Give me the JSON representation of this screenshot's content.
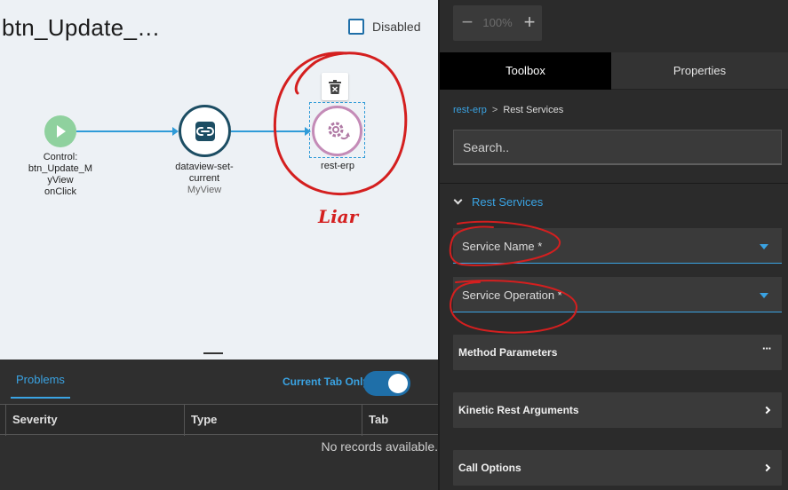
{
  "canvas": {
    "title": "btn_Update_…",
    "disabled_label": "Disabled",
    "nodes": {
      "start": {
        "line1": "Control:",
        "line2": "btn_Update_M",
        "line3": "yView",
        "line4": "onClick"
      },
      "dataview": {
        "line1": "dataview-set-",
        "line2": "current",
        "sub": "MyView"
      },
      "rest": {
        "label": "rest-erp"
      }
    },
    "annotation_text": "Liar"
  },
  "problems": {
    "tab_label": "Problems",
    "current_tab_only_label": "Current Tab Only",
    "current_tab_only": true,
    "columns": [
      "Severity",
      "Type",
      "Tab"
    ],
    "empty_text": "No records available."
  },
  "right_panel": {
    "zoom": {
      "minus": "−",
      "value": "100%",
      "plus": "+"
    },
    "tabs": {
      "toolbox": "Toolbox",
      "properties": "Properties"
    },
    "breadcrumb": {
      "root": "rest-erp",
      "separator": ">",
      "current": "Rest Services"
    },
    "search_placeholder": "Search..",
    "section_title": "Rest Services",
    "fields": {
      "service_name": "Service Name *",
      "service_operation": "Service Operation *"
    },
    "groups": {
      "method_parameters": "Method Parameters",
      "kinetic_rest_arguments": "Kinetic Rest Arguments",
      "call_options": "Call Options",
      "more": "···"
    }
  },
  "colors": {
    "accent": "#3aa3e3",
    "annotation": "#d41f1f",
    "start_node": "#8fd19e",
    "dataview_node": "#1c4d63",
    "rest_node": "#c48bb7"
  },
  "icons": [
    "play-icon",
    "link-icon",
    "gear-sync-icon",
    "trash-icon",
    "chevron-down-icon",
    "chevron-right-icon",
    "more-icon",
    "caret-down-icon"
  ]
}
